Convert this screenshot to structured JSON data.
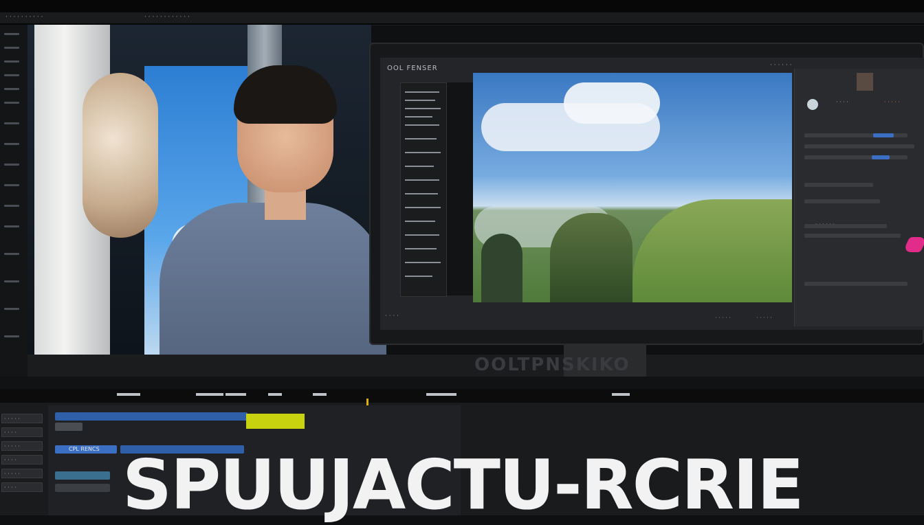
{
  "topbar": {
    "left_label": "· · · · · · · · · ·",
    "center_label": "· · · · · · · · · · · ·"
  },
  "monitor": {
    "title": "OOL FENSER",
    "right_label": "· · · · · ·",
    "panel_labels": [
      "· · · ·",
      "· · · · ·",
      "· · · · · ·"
    ],
    "bottom_label": "· · · ·",
    "bottom_label_2": "· · · · ·",
    "bottom_label_3": "· · · · ·"
  },
  "desk": {
    "watermark": "OOLTPNSKIKO"
  },
  "timeline": {
    "track_labels": [
      "· · · · ·",
      "· · · ·",
      "· · · · ·",
      "· · · ·",
      "· · · · ·",
      "· · · ·"
    ],
    "clip_label": "CPL RENCS"
  },
  "overlay": {
    "title": "SPUUJACTU-RCRIE"
  },
  "colors": {
    "accent_yellow": "#c9d20f",
    "playhead": "#e0b000",
    "pink": "#e22c8a",
    "track_blue": "#3b6fc4"
  }
}
